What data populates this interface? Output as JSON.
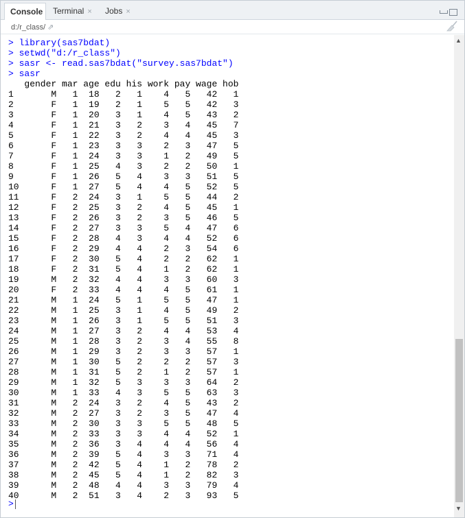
{
  "tabs": [
    {
      "label": "Console",
      "closable": false,
      "active": true
    },
    {
      "label": "Terminal",
      "closable": true,
      "active": false
    },
    {
      "label": "Jobs",
      "closable": true,
      "active": false
    }
  ],
  "icons": {
    "close": "×",
    "path_link": "⇗",
    "clear": "broom-icon",
    "scroll_up": "▲",
    "scroll_down": "▼"
  },
  "path": "d:/r_class/",
  "commands": [
    "> library(sas7bdat)",
    "> setwd(\"d:/r_class\")",
    "> sasr <- read.sas7bdat(\"survey.sas7bdat\")",
    "> sasr"
  ],
  "table": {
    "headers": [
      "gender",
      "mar",
      "age",
      "edu",
      "his",
      "work",
      "pay",
      "wage",
      "hob"
    ],
    "rows": [
      [
        "1",
        "M",
        "1",
        "18",
        "2",
        "1",
        "4",
        "5",
        "42",
        "1"
      ],
      [
        "2",
        "F",
        "1",
        "19",
        "2",
        "1",
        "5",
        "5",
        "42",
        "3"
      ],
      [
        "3",
        "F",
        "1",
        "20",
        "3",
        "1",
        "4",
        "5",
        "43",
        "2"
      ],
      [
        "4",
        "F",
        "1",
        "21",
        "3",
        "2",
        "3",
        "4",
        "45",
        "7"
      ],
      [
        "5",
        "F",
        "1",
        "22",
        "3",
        "2",
        "4",
        "4",
        "45",
        "3"
      ],
      [
        "6",
        "F",
        "1",
        "23",
        "3",
        "3",
        "2",
        "3",
        "47",
        "5"
      ],
      [
        "7",
        "F",
        "1",
        "24",
        "3",
        "3",
        "1",
        "2",
        "49",
        "5"
      ],
      [
        "8",
        "F",
        "1",
        "25",
        "4",
        "3",
        "2",
        "2",
        "50",
        "1"
      ],
      [
        "9",
        "F",
        "1",
        "26",
        "5",
        "4",
        "3",
        "3",
        "51",
        "5"
      ],
      [
        "10",
        "F",
        "1",
        "27",
        "5",
        "4",
        "4",
        "5",
        "52",
        "5"
      ],
      [
        "11",
        "F",
        "2",
        "24",
        "3",
        "1",
        "5",
        "5",
        "44",
        "2"
      ],
      [
        "12",
        "F",
        "2",
        "25",
        "3",
        "2",
        "4",
        "5",
        "45",
        "1"
      ],
      [
        "13",
        "F",
        "2",
        "26",
        "3",
        "2",
        "3",
        "5",
        "46",
        "5"
      ],
      [
        "14",
        "F",
        "2",
        "27",
        "3",
        "3",
        "5",
        "4",
        "47",
        "6"
      ],
      [
        "15",
        "F",
        "2",
        "28",
        "4",
        "3",
        "4",
        "4",
        "52",
        "6"
      ],
      [
        "16",
        "F",
        "2",
        "29",
        "4",
        "4",
        "2",
        "3",
        "54",
        "6"
      ],
      [
        "17",
        "F",
        "2",
        "30",
        "5",
        "4",
        "2",
        "2",
        "62",
        "1"
      ],
      [
        "18",
        "F",
        "2",
        "31",
        "5",
        "4",
        "1",
        "2",
        "62",
        "1"
      ],
      [
        "19",
        "M",
        "2",
        "32",
        "4",
        "4",
        "3",
        "3",
        "60",
        "3"
      ],
      [
        "20",
        "F",
        "2",
        "33",
        "4",
        "4",
        "4",
        "5",
        "61",
        "1"
      ],
      [
        "21",
        "M",
        "1",
        "24",
        "5",
        "1",
        "5",
        "5",
        "47",
        "1"
      ],
      [
        "22",
        "M",
        "1",
        "25",
        "3",
        "1",
        "4",
        "5",
        "49",
        "2"
      ],
      [
        "23",
        "M",
        "1",
        "26",
        "3",
        "1",
        "5",
        "5",
        "51",
        "3"
      ],
      [
        "24",
        "M",
        "1",
        "27",
        "3",
        "2",
        "4",
        "4",
        "53",
        "4"
      ],
      [
        "25",
        "M",
        "1",
        "28",
        "3",
        "2",
        "3",
        "4",
        "55",
        "8"
      ],
      [
        "26",
        "M",
        "1",
        "29",
        "3",
        "2",
        "3",
        "3",
        "57",
        "1"
      ],
      [
        "27",
        "M",
        "1",
        "30",
        "5",
        "2",
        "2",
        "2",
        "57",
        "3"
      ],
      [
        "28",
        "M",
        "1",
        "31",
        "5",
        "2",
        "1",
        "2",
        "57",
        "1"
      ],
      [
        "29",
        "M",
        "1",
        "32",
        "5",
        "3",
        "3",
        "3",
        "64",
        "2"
      ],
      [
        "30",
        "M",
        "1",
        "33",
        "4",
        "3",
        "5",
        "5",
        "63",
        "3"
      ],
      [
        "31",
        "M",
        "2",
        "24",
        "3",
        "2",
        "4",
        "5",
        "43",
        "2"
      ],
      [
        "32",
        "M",
        "2",
        "27",
        "3",
        "2",
        "3",
        "5",
        "47",
        "4"
      ],
      [
        "33",
        "M",
        "2",
        "30",
        "3",
        "3",
        "5",
        "5",
        "48",
        "5"
      ],
      [
        "34",
        "M",
        "2",
        "33",
        "3",
        "3",
        "4",
        "4",
        "52",
        "1"
      ],
      [
        "35",
        "M",
        "2",
        "36",
        "3",
        "4",
        "4",
        "4",
        "56",
        "4"
      ],
      [
        "36",
        "M",
        "2",
        "39",
        "5",
        "4",
        "3",
        "3",
        "71",
        "4"
      ],
      [
        "37",
        "M",
        "2",
        "42",
        "5",
        "4",
        "1",
        "2",
        "78",
        "2"
      ],
      [
        "38",
        "M",
        "2",
        "45",
        "5",
        "4",
        "1",
        "2",
        "82",
        "3"
      ],
      [
        "39",
        "M",
        "2",
        "48",
        "4",
        "4",
        "3",
        "3",
        "79",
        "4"
      ],
      [
        "40",
        "M",
        "2",
        "51",
        "3",
        "4",
        "2",
        "3",
        "93",
        "5"
      ]
    ]
  },
  "prompt": ">"
}
